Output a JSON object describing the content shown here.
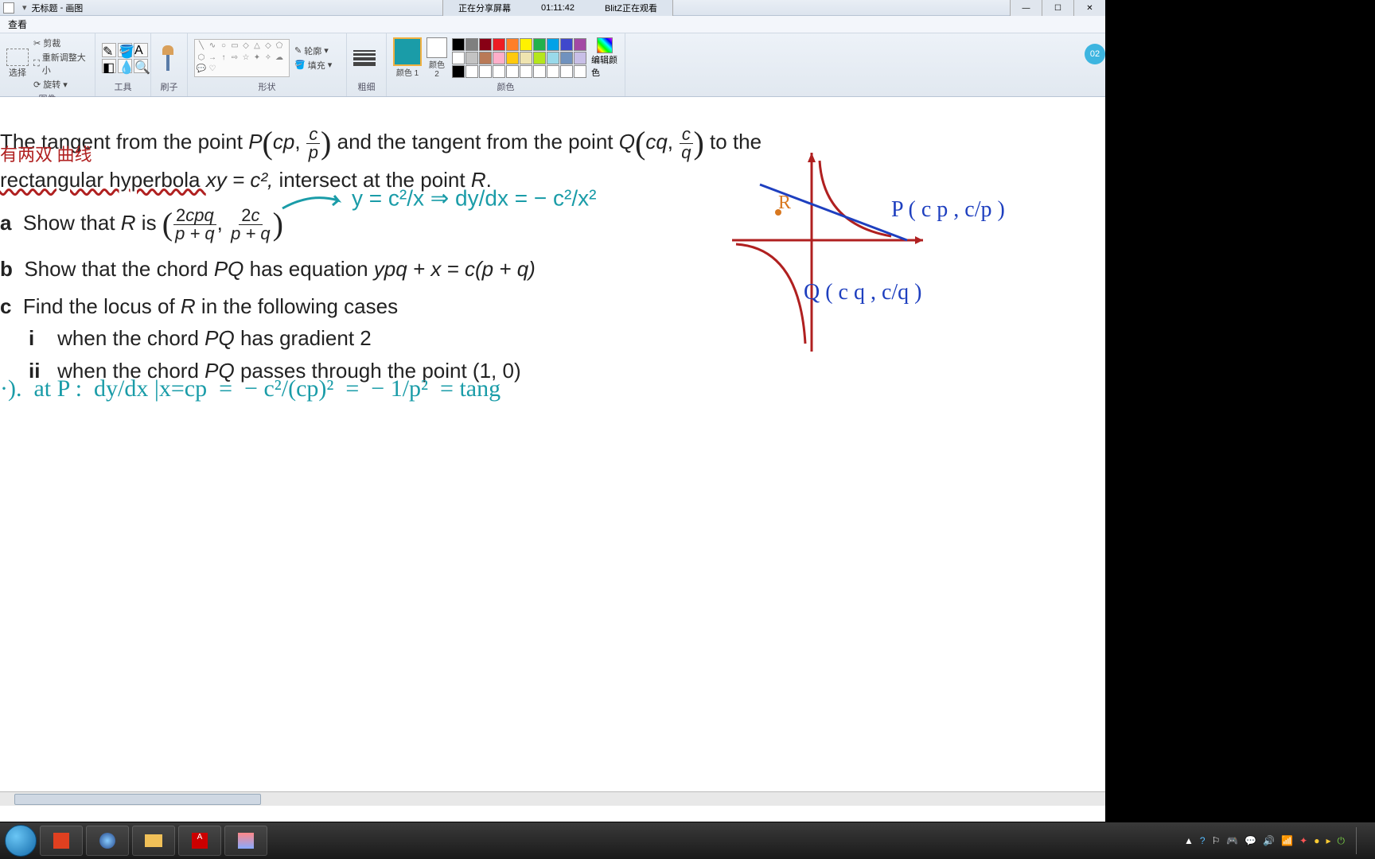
{
  "titlebar": {
    "doc": "无标题",
    "app": "画图"
  },
  "menubar": {
    "view": "查看"
  },
  "share": {
    "status": "正在分享屏幕",
    "time": "01:11:42",
    "watcher": "BlitZ正在观看"
  },
  "ribbon": {
    "image": {
      "label": "图像",
      "select": "选择",
      "crop": "剪裁",
      "resize": "重新调整大小",
      "rotate": "旋转"
    },
    "tools": {
      "label": "工具"
    },
    "brush": {
      "label": "刷子"
    },
    "shapes": {
      "label": "形状",
      "outline": "轮廓",
      "fill": "填充"
    },
    "thickness": {
      "label": "粗细"
    },
    "color1": {
      "label": "颜色 1"
    },
    "color2": {
      "label": "颜色 2"
    },
    "colors": {
      "label": "颜色",
      "edit": "编辑颜色"
    }
  },
  "palette_colors": [
    "#000000",
    "#7f7f7f",
    "#880015",
    "#ed1c24",
    "#ff7f27",
    "#fff200",
    "#22b14c",
    "#00a2e8",
    "#3f48cc",
    "#a349a4",
    "#ffffff",
    "#c3c3c3",
    "#b97a57",
    "#ffaec9",
    "#ffc90e",
    "#efe4b0",
    "#b5e61d",
    "#99d9ea",
    "#7092be",
    "#c8bfe7",
    "#000000",
    "#ffffff",
    "#ffffff",
    "#ffffff",
    "#ffffff",
    "#ffffff",
    "#ffffff",
    "#ffffff",
    "#ffffff",
    "#ffffff"
  ],
  "problem": {
    "line1a": "The tangent from the point ",
    "line1b": " and the tangent from the point ",
    "line1c": " to the",
    "line2": "rectangular hyperbola ",
    "line2eq": "xy = c²,",
    "line2b": " intersect at the point ",
    "a": "Show that ",
    "a2": " is ",
    "b": "Show that the chord ",
    "b2": " has equation ",
    "beq": "ypq + x = c(p + q)",
    "c": "Find the locus of ",
    "c2": " in the following cases",
    "ci": "when the chord ",
    "ci2": " has gradient 2",
    "cii": "when the chord ",
    "cii2": " passes through the point (1, 0)"
  },
  "handwriting": {
    "red_note": "有两双 曲线",
    "arrow_eq": "y = c²/x  ⇒  dy/dx = − c²/x²",
    "work_line": "·).  at P :  dy/dx |x=cp  =  − c²/(cp)²  =  − 1/p²  = tang",
    "graph_R": "R",
    "graph_P": "P ( c p , c/p )",
    "graph_Q": "Q ( c q , c/q )"
  },
  "notif": "02",
  "taskbar_apps": [
    "foxit",
    "browser",
    "explorer",
    "adobe",
    "paint"
  ]
}
